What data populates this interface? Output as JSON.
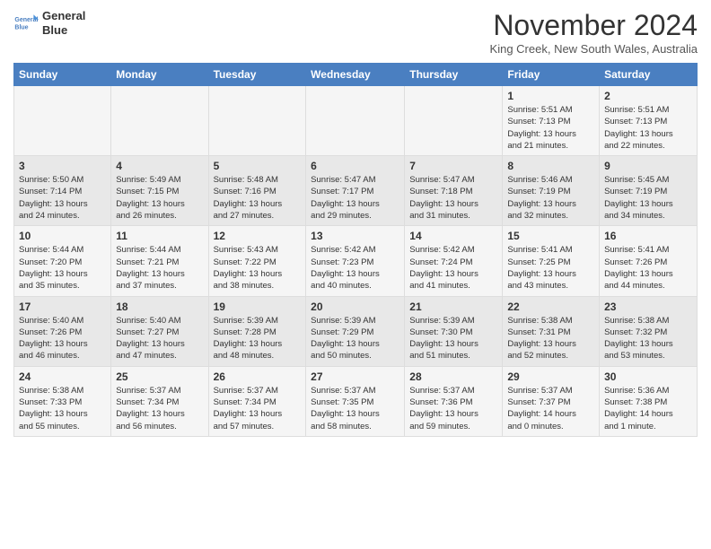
{
  "logo": {
    "line1": "General",
    "line2": "Blue"
  },
  "title": "November 2024",
  "location": "King Creek, New South Wales, Australia",
  "days_of_week": [
    "Sunday",
    "Monday",
    "Tuesday",
    "Wednesday",
    "Thursday",
    "Friday",
    "Saturday"
  ],
  "weeks": [
    [
      {
        "day": "",
        "info": ""
      },
      {
        "day": "",
        "info": ""
      },
      {
        "day": "",
        "info": ""
      },
      {
        "day": "",
        "info": ""
      },
      {
        "day": "",
        "info": ""
      },
      {
        "day": "1",
        "info": "Sunrise: 5:51 AM\nSunset: 7:13 PM\nDaylight: 13 hours\nand 21 minutes."
      },
      {
        "day": "2",
        "info": "Sunrise: 5:51 AM\nSunset: 7:13 PM\nDaylight: 13 hours\nand 22 minutes."
      }
    ],
    [
      {
        "day": "3",
        "info": "Sunrise: 5:50 AM\nSunset: 7:14 PM\nDaylight: 13 hours\nand 24 minutes."
      },
      {
        "day": "4",
        "info": "Sunrise: 5:49 AM\nSunset: 7:15 PM\nDaylight: 13 hours\nand 26 minutes."
      },
      {
        "day": "5",
        "info": "Sunrise: 5:48 AM\nSunset: 7:16 PM\nDaylight: 13 hours\nand 27 minutes."
      },
      {
        "day": "6",
        "info": "Sunrise: 5:47 AM\nSunset: 7:17 PM\nDaylight: 13 hours\nand 29 minutes."
      },
      {
        "day": "7",
        "info": "Sunrise: 5:47 AM\nSunset: 7:18 PM\nDaylight: 13 hours\nand 31 minutes."
      },
      {
        "day": "8",
        "info": "Sunrise: 5:46 AM\nSunset: 7:19 PM\nDaylight: 13 hours\nand 32 minutes."
      },
      {
        "day": "9",
        "info": "Sunrise: 5:45 AM\nSunset: 7:19 PM\nDaylight: 13 hours\nand 34 minutes."
      }
    ],
    [
      {
        "day": "10",
        "info": "Sunrise: 5:44 AM\nSunset: 7:20 PM\nDaylight: 13 hours\nand 35 minutes."
      },
      {
        "day": "11",
        "info": "Sunrise: 5:44 AM\nSunset: 7:21 PM\nDaylight: 13 hours\nand 37 minutes."
      },
      {
        "day": "12",
        "info": "Sunrise: 5:43 AM\nSunset: 7:22 PM\nDaylight: 13 hours\nand 38 minutes."
      },
      {
        "day": "13",
        "info": "Sunrise: 5:42 AM\nSunset: 7:23 PM\nDaylight: 13 hours\nand 40 minutes."
      },
      {
        "day": "14",
        "info": "Sunrise: 5:42 AM\nSunset: 7:24 PM\nDaylight: 13 hours\nand 41 minutes."
      },
      {
        "day": "15",
        "info": "Sunrise: 5:41 AM\nSunset: 7:25 PM\nDaylight: 13 hours\nand 43 minutes."
      },
      {
        "day": "16",
        "info": "Sunrise: 5:41 AM\nSunset: 7:26 PM\nDaylight: 13 hours\nand 44 minutes."
      }
    ],
    [
      {
        "day": "17",
        "info": "Sunrise: 5:40 AM\nSunset: 7:26 PM\nDaylight: 13 hours\nand 46 minutes."
      },
      {
        "day": "18",
        "info": "Sunrise: 5:40 AM\nSunset: 7:27 PM\nDaylight: 13 hours\nand 47 minutes."
      },
      {
        "day": "19",
        "info": "Sunrise: 5:39 AM\nSunset: 7:28 PM\nDaylight: 13 hours\nand 48 minutes."
      },
      {
        "day": "20",
        "info": "Sunrise: 5:39 AM\nSunset: 7:29 PM\nDaylight: 13 hours\nand 50 minutes."
      },
      {
        "day": "21",
        "info": "Sunrise: 5:39 AM\nSunset: 7:30 PM\nDaylight: 13 hours\nand 51 minutes."
      },
      {
        "day": "22",
        "info": "Sunrise: 5:38 AM\nSunset: 7:31 PM\nDaylight: 13 hours\nand 52 minutes."
      },
      {
        "day": "23",
        "info": "Sunrise: 5:38 AM\nSunset: 7:32 PM\nDaylight: 13 hours\nand 53 minutes."
      }
    ],
    [
      {
        "day": "24",
        "info": "Sunrise: 5:38 AM\nSunset: 7:33 PM\nDaylight: 13 hours\nand 55 minutes."
      },
      {
        "day": "25",
        "info": "Sunrise: 5:37 AM\nSunset: 7:34 PM\nDaylight: 13 hours\nand 56 minutes."
      },
      {
        "day": "26",
        "info": "Sunrise: 5:37 AM\nSunset: 7:34 PM\nDaylight: 13 hours\nand 57 minutes."
      },
      {
        "day": "27",
        "info": "Sunrise: 5:37 AM\nSunset: 7:35 PM\nDaylight: 13 hours\nand 58 minutes."
      },
      {
        "day": "28",
        "info": "Sunrise: 5:37 AM\nSunset: 7:36 PM\nDaylight: 13 hours\nand 59 minutes."
      },
      {
        "day": "29",
        "info": "Sunrise: 5:37 AM\nSunset: 7:37 PM\nDaylight: 14 hours\nand 0 minutes."
      },
      {
        "day": "30",
        "info": "Sunrise: 5:36 AM\nSunset: 7:38 PM\nDaylight: 14 hours\nand 1 minute."
      }
    ]
  ]
}
